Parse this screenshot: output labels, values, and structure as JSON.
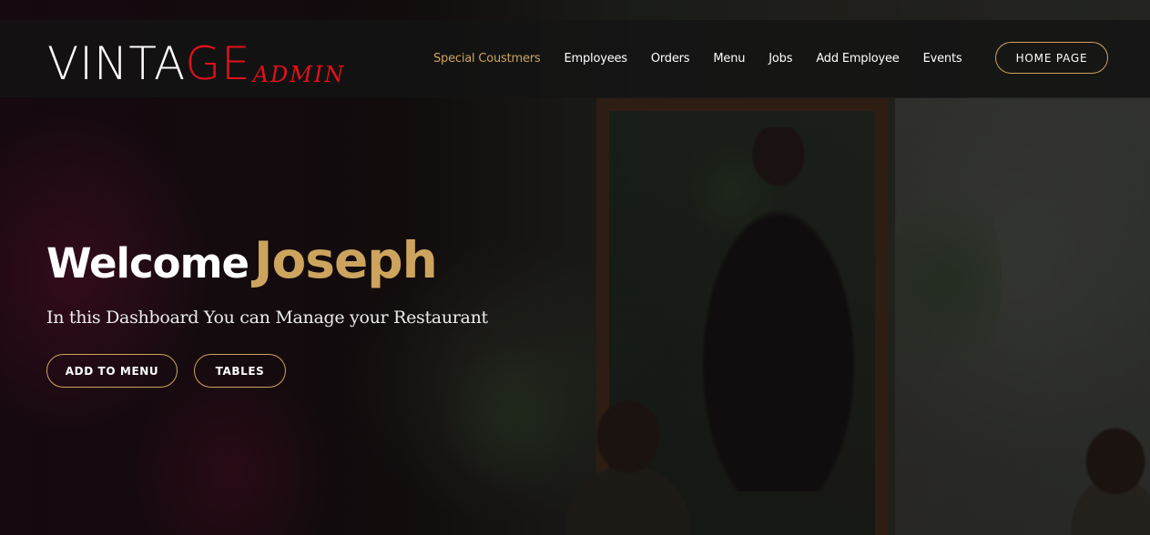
{
  "brand": {
    "logo_prefix": "VINTA",
    "logo_red": "GE",
    "logo_sub": "ADMIN",
    "red_color": "#e3101b",
    "accent_color": "#cda45e"
  },
  "nav": {
    "items": [
      {
        "label": "Special Coustmers",
        "active": true
      },
      {
        "label": "Employees",
        "active": false
      },
      {
        "label": "Orders",
        "active": false
      },
      {
        "label": "Menu",
        "active": false
      },
      {
        "label": "Jobs",
        "active": false
      },
      {
        "label": "Add Employee",
        "active": false
      },
      {
        "label": "Events",
        "active": false
      }
    ],
    "home_button": "HOME PAGE"
  },
  "hero": {
    "welcome": "Welcome",
    "name": "Joseph",
    "subtitle": "In this Dashboard You can Manage your Restaurant",
    "buttons": {
      "add_to_menu": "ADD TO MENU",
      "tables": "TABLES"
    }
  }
}
